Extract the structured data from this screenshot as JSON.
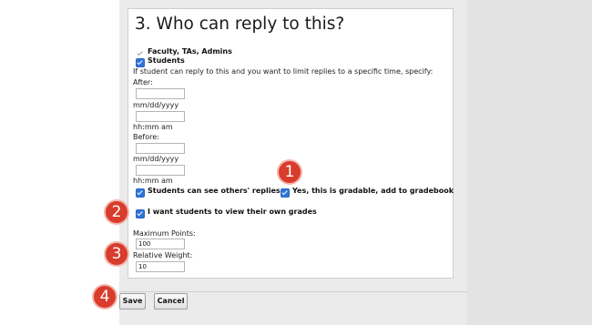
{
  "section": {
    "title": "3. Who can reply to this?"
  },
  "reply_options": {
    "faculty_label": "Faculty, TAs, Admins",
    "students_label": "Students",
    "limit_instructions": "If student can reply to this and you want to limit replies to a specific time, specify:",
    "after_label": "After:",
    "after_date_hint": "mm/dd/yyyy",
    "after_time_hint": "hh:mm am",
    "before_label": "Before:",
    "before_date_hint": "mm/dd/yyyy",
    "before_time_hint": "hh:mm am",
    "see_others_label": "Students can see others' replies",
    "gradable_label": "Yes, this is gradable, add to gradebook",
    "view_grades_label": "I want students to view their own grades"
  },
  "grading": {
    "max_points_label": "Maximum Points:",
    "max_points_value": "100",
    "weight_label": "Relative Weight:",
    "weight_value": "10"
  },
  "actions": {
    "save_label": "Save",
    "cancel_label": "Cancel"
  },
  "markers": [
    "1",
    "2",
    "3",
    "4"
  ],
  "colors": {
    "checkbox": "#2f74d8",
    "marker": "#d83c2c"
  }
}
